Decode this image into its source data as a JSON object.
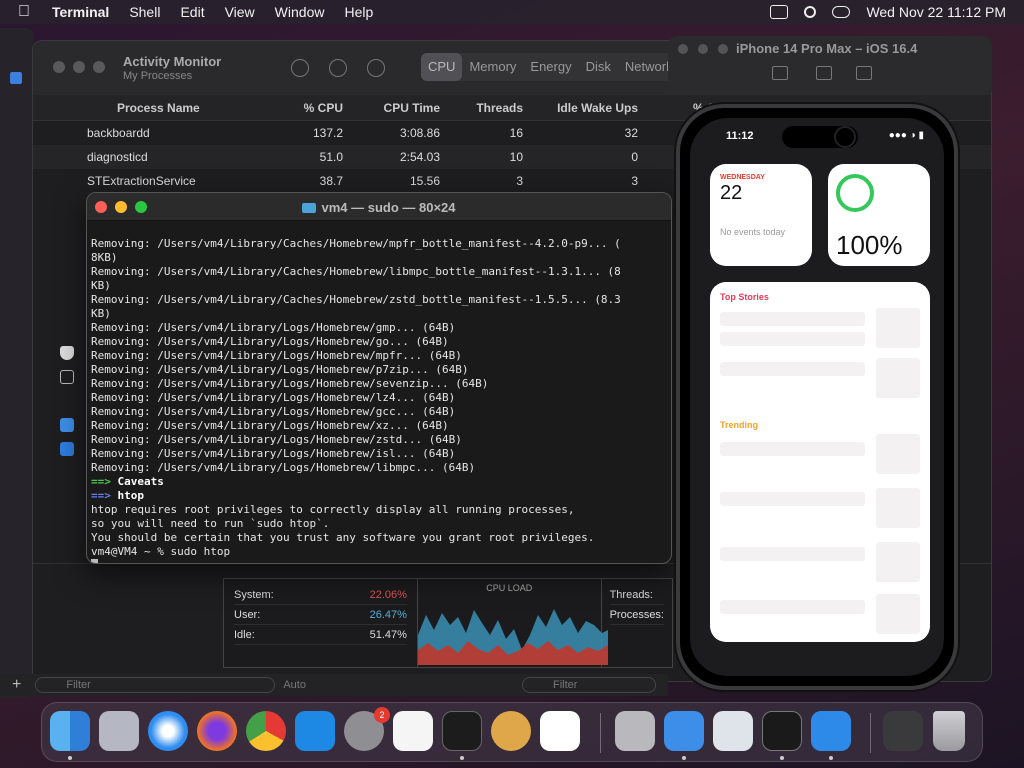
{
  "menubar": {
    "app": "Terminal",
    "items": [
      "Shell",
      "Edit",
      "View",
      "Window",
      "Help"
    ],
    "datetime": "Wed Nov 22  11:12 PM"
  },
  "activity_monitor": {
    "title": "Activity Monitor",
    "subtitle": "My Processes",
    "tabs": [
      "CPU",
      "Memory",
      "Energy",
      "Disk",
      "Network"
    ],
    "columns": [
      "Process Name",
      "% CPU",
      "CPU Time",
      "Threads",
      "Idle Wake Ups",
      "% GPU"
    ],
    "rows": [
      [
        "backboardd",
        "137.2",
        "3:08.86",
        "16",
        "32"
      ],
      [
        "diagnosticd",
        "51.0",
        "2:54.03",
        "10",
        "0"
      ],
      [
        "STExtractionService",
        "38.7",
        "15.56",
        "3",
        "3"
      ]
    ],
    "stats": {
      "system_label": "System:",
      "system_value": "22.06%",
      "user_label": "User:",
      "user_value": "26.47%",
      "idle_label": "Idle:",
      "idle_value": "51.47%",
      "cpu_load_label": "CPU LOAD",
      "threads_label": "Threads:",
      "processes_label": "Processes:"
    },
    "footer": {
      "filter_left": "Filter",
      "auto": "Auto",
      "filter_right": "Filter"
    }
  },
  "terminal": {
    "title": "vm4 — sudo — 80×24",
    "lines": [
      "Removing: /Users/vm4/Library/Caches/Homebrew/mpfr_bottle_manifest--4.2.0-p9... (",
      "8KB)",
      "Removing: /Users/vm4/Library/Caches/Homebrew/libmpc_bottle_manifest--1.3.1... (8",
      "KB)",
      "Removing: /Users/vm4/Library/Caches/Homebrew/zstd_bottle_manifest--1.5.5... (8.3",
      "KB)",
      "Removing: /Users/vm4/Library/Logs/Homebrew/gmp... (64B)",
      "Removing: /Users/vm4/Library/Logs/Homebrew/go... (64B)",
      "Removing: /Users/vm4/Library/Logs/Homebrew/mpfr... (64B)",
      "Removing: /Users/vm4/Library/Logs/Homebrew/p7zip... (64B)",
      "Removing: /Users/vm4/Library/Logs/Homebrew/sevenzip... (64B)",
      "Removing: /Users/vm4/Library/Logs/Homebrew/lz4... (64B)",
      "Removing: /Users/vm4/Library/Logs/Homebrew/gcc... (64B)",
      "Removing: /Users/vm4/Library/Logs/Homebrew/xz... (64B)",
      "Removing: /Users/vm4/Library/Logs/Homebrew/zstd... (64B)",
      "Removing: /Users/vm4/Library/Logs/Homebrew/isl... (64B)",
      "Removing: /Users/vm4/Library/Logs/Homebrew/libmpc... (64B)"
    ],
    "caveats_arrow": "==>",
    "caveats": "Caveats",
    "htop_arrow": "==>",
    "htop": "htop",
    "message": [
      "htop requires root privileges to correctly display all running processes,",
      "so you will need to run `sudo htop`.",
      "You should be certain that you trust any software you grant root privileges."
    ],
    "prompt": "vm4@VM4 ~ % sudo htop"
  },
  "simulator": {
    "title": "iPhone 14 Pro Max – iOS 16.4",
    "time": "11:12",
    "calendar": {
      "day": "WEDNESDAY",
      "date": "22",
      "events": "No events today"
    },
    "battery": {
      "percent": "100%"
    },
    "news": {
      "top_stories": "Top Stories",
      "trending": "Trending"
    }
  },
  "dock": {
    "settings_badge": "2",
    "icons": [
      "finder-icon",
      "launchpad-icon",
      "safari-icon",
      "firefox-icon",
      "chrome-icon",
      "app-store-icon",
      "system-settings-icon",
      "textedit-icon",
      "terminal-icon",
      "garageband-icon",
      "vscode-icon",
      "installer-icon",
      "xcode-icon",
      "preview-icon",
      "activity-monitor-icon",
      "simulator-icon",
      "downloads-stack-icon",
      "trash-icon"
    ]
  }
}
